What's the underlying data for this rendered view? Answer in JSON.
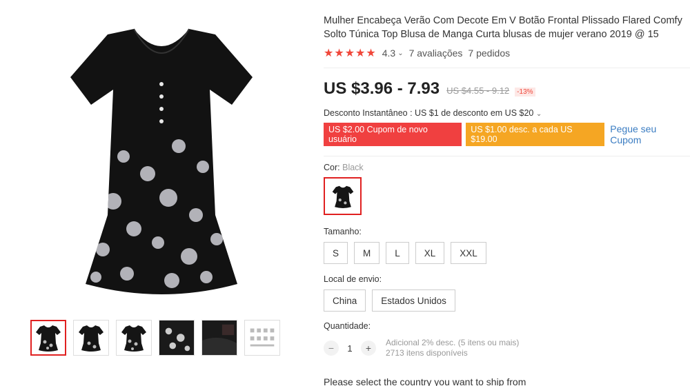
{
  "product": {
    "title": "Mulher Encabeça Verão Com Decote Em V Botão Frontal Plissado Flared Comfy Solto Túnica Top Blusa de Manga Curta blusas de mujer verano 2019 @ 15",
    "rating": {
      "stars": "★★★★★",
      "score": "4.3",
      "reviews": "7 avaliações",
      "orders": "7 pedidos"
    },
    "price": "US $3.96 - 7.93",
    "old_price": "US $4.55 - 9.12",
    "discount": "-13%",
    "instant_discount": "Desconto Instantâneo : US $1 de desconto em US $20",
    "coupons": {
      "new_user": "US $2.00 Cupom de novo usuário",
      "per_spend": "US $1.00 desc. a cada US $19.00",
      "get_coupon": "Pegue seu Cupom"
    }
  },
  "options": {
    "color_label": "Cor:",
    "color_value": "Black",
    "size_label": "Tamanho:",
    "sizes": [
      "S",
      "M",
      "L",
      "XL",
      "XXL"
    ],
    "ship_label": "Local de envio:",
    "ship_from": [
      "China",
      "Estados Unidos"
    ],
    "qty_label": "Quantidade:",
    "qty_value": "1",
    "qty_minus": "−",
    "qty_plus": "+",
    "qty_note": "Adicional 2% desc. (5 itens ou mais)",
    "stock": "2713 itens disponíveis",
    "ship_message": "Please select the country you want to ship from"
  },
  "colors": {
    "accent_red": "#f04040",
    "accent_orange": "#f5a623",
    "link_blue": "#3a7cc2"
  }
}
